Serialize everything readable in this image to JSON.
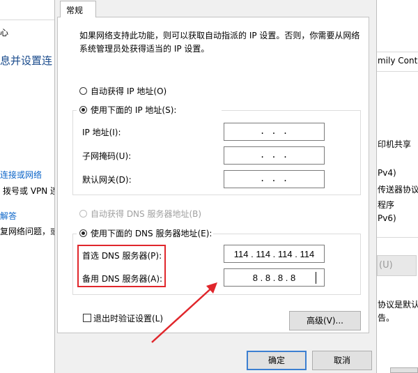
{
  "background": {
    "left_lines": [
      "心",
      "息并设置连",
      "连接或网络",
      "拨号或 VPN 连",
      "解答",
      "复网络问题，或获"
    ],
    "right_lines": [
      "mily Contr",
      "印机共享",
      "Pv4)",
      "传送器协议",
      "程序",
      "Pv6)",
      "(U)",
      "协议是默认",
      "告。"
    ]
  },
  "dialog": {
    "tab_label": "常规",
    "description": "如果网络支持此功能，则可以获取自动指派的 IP 设置。否则，你需要从网络系统管理员处获得适当的 IP 设置。",
    "ip": {
      "auto_radio": "自动获得 IP 地址(O)",
      "manual_radio": "使用下面的 IP 地址(S):",
      "fields": [
        {
          "label": "IP 地址(I):",
          "value": ".   .   ."
        },
        {
          "label": "子网掩码(U):",
          "value": ".   .   ."
        },
        {
          "label": "默认网关(D):",
          "value": ".   .   ."
        }
      ]
    },
    "dns": {
      "auto_radio": "自动获得 DNS 服务器地址(B)",
      "manual_radio": "使用下面的 DNS 服务器地址(E):",
      "preferred_label": "首选 DNS 服务器(P):",
      "preferred_value": "114 . 114 . 114 . 114",
      "alternate_label": "备用 DNS 服务器(A):",
      "alternate_value": "8 . 8 . 8 . 8"
    },
    "validate_checkbox": "退出时验证设置(L)",
    "advanced_button": "高级(V)...",
    "ok_button": "确定",
    "cancel_button": "取消"
  },
  "colors": {
    "annotation_red": "#e0262b",
    "primary_button_border": "#3c7fd1"
  }
}
